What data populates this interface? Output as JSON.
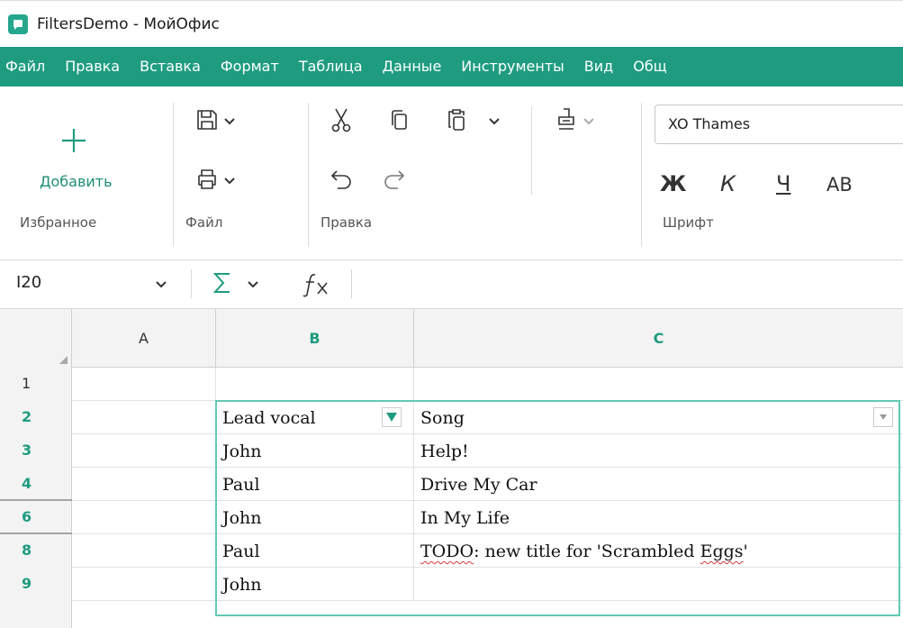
{
  "window": {
    "title": "FiltersDemo - МойОфис"
  },
  "menu": {
    "items": [
      "Файл",
      "Правка",
      "Вставка",
      "Формат",
      "Таблица",
      "Данные",
      "Инструменты",
      "Вид",
      "Общ"
    ]
  },
  "ribbon": {
    "add_label": "Добавить",
    "groups": {
      "favorites": "Избранное",
      "file": "Файл",
      "edit": "Правка",
      "font": "Шрифт"
    },
    "font_name": "XO Thames",
    "format_buttons": {
      "bold": "Ж",
      "italic": "К",
      "underline": "Ч",
      "caps": "АВ"
    }
  },
  "formula_bar": {
    "cell_ref": "I20"
  },
  "sheet": {
    "columns": [
      "A",
      "B",
      "C"
    ],
    "rows": [
      {
        "num": "1",
        "a": "",
        "b": "",
        "c": ""
      },
      {
        "num": "2",
        "a": "",
        "b": "Lead vocal",
        "c": "Song"
      },
      {
        "num": "3",
        "a": "",
        "b": "John",
        "c": "Help!"
      },
      {
        "num": "4",
        "a": "",
        "b": "Paul",
        "c": "Drive My Car"
      },
      {
        "num": "6",
        "a": "",
        "b": "John",
        "c": "In My Life"
      },
      {
        "num": "8",
        "a": "",
        "b": "Paul",
        "c": "TODO: new title for 'Scrambled Eggs'"
      },
      {
        "num": "9",
        "a": "",
        "b": "John",
        "c": ""
      }
    ],
    "todo_parts": {
      "word1": "TODO",
      "rest1": ": new title for 'Scrambled ",
      "word2": "Eggs",
      "rest2": "'"
    }
  },
  "colors": {
    "accent": "#1f9c80",
    "selection": "#64c8b3"
  }
}
